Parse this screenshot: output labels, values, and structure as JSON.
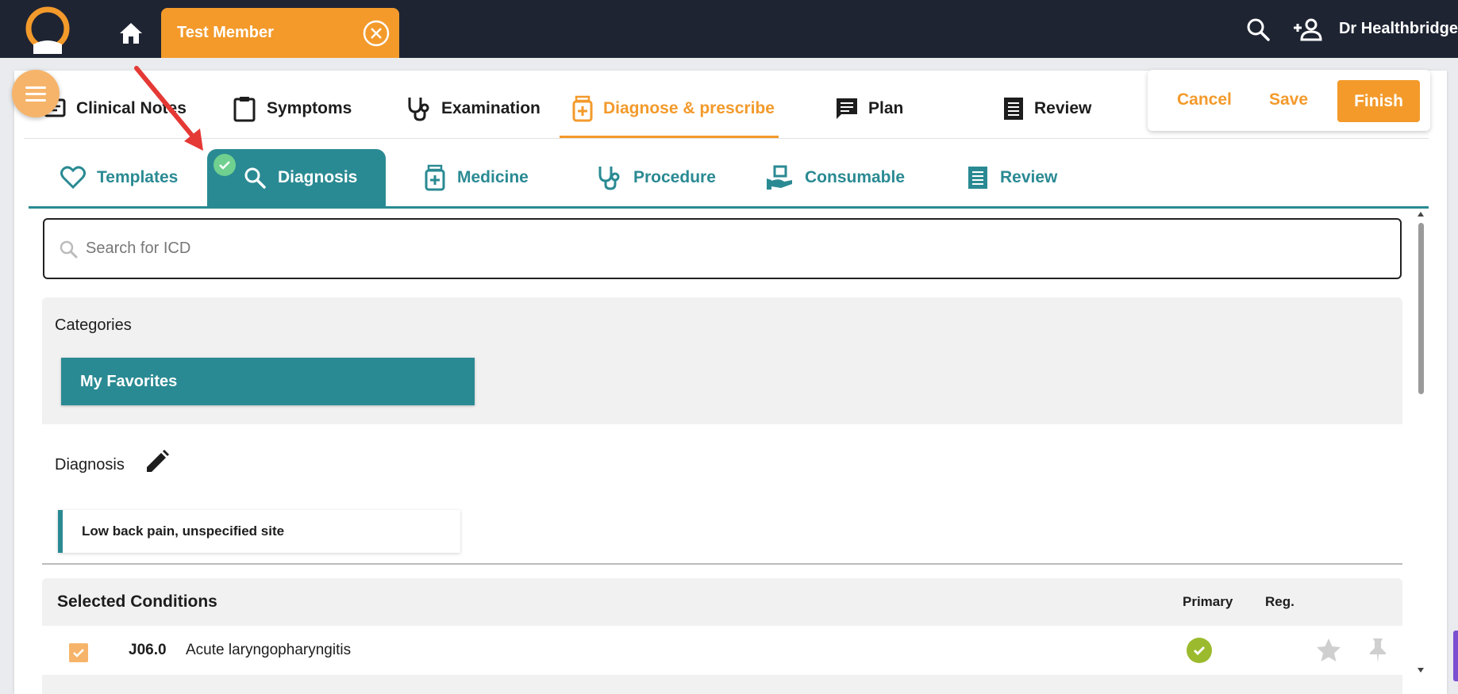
{
  "header": {
    "patient_tab": "Test Member",
    "user_name": "Dr Healthbridge"
  },
  "main_tabs": [
    {
      "label": "Clinical Notes",
      "icon": "notes-icon"
    },
    {
      "label": "Symptoms",
      "icon": "clipboard-icon"
    },
    {
      "label": "Examination",
      "icon": "stethoscope-icon"
    },
    {
      "label": "Diagnose & prescribe",
      "icon": "medicine-bottle-icon",
      "active": true
    },
    {
      "label": "Plan",
      "icon": "comment-icon"
    },
    {
      "label": "Review",
      "icon": "receipt-icon"
    }
  ],
  "actions": {
    "cancel": "Cancel",
    "save": "Save",
    "finish": "Finish"
  },
  "sub_tabs": [
    {
      "label": "Templates",
      "icon": "heart-icon"
    },
    {
      "label": "Diagnosis",
      "icon": "search-icon",
      "active": true,
      "completed": true
    },
    {
      "label": "Medicine",
      "icon": "medicine-bottle-icon"
    },
    {
      "label": "Procedure",
      "icon": "stethoscope-icon"
    },
    {
      "label": "Consumable",
      "icon": "hand-box-icon"
    },
    {
      "label": "Review",
      "icon": "receipt-icon"
    }
  ],
  "search": {
    "placeholder": "Search for ICD",
    "value": ""
  },
  "categories": {
    "title": "Categories",
    "items": [
      "My Favorites"
    ]
  },
  "diagnosis": {
    "title": "Diagnosis",
    "items": [
      "Low back pain, unspecified site"
    ]
  },
  "selected_conditions": {
    "title": "Selected Conditions",
    "col_primary": "Primary",
    "col_reg": "Reg.",
    "rows": [
      {
        "code": "J06.0",
        "description": "Acute laryngopharyngitis",
        "checked": true,
        "primary": true
      }
    ]
  },
  "colors": {
    "accent_orange": "#f39a2b",
    "teal": "#2a8a93",
    "topbar": "#1f2433",
    "primary_green": "#9bba2e"
  }
}
